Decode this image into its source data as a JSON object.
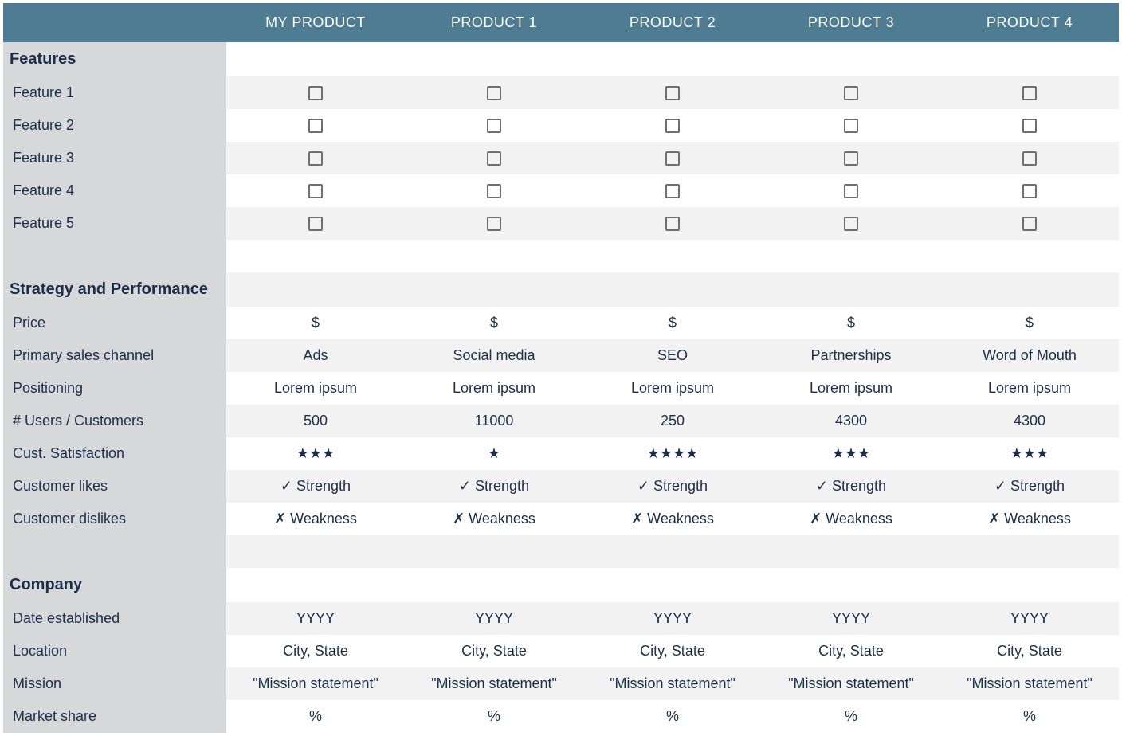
{
  "columns": [
    "MY PRODUCT",
    "PRODUCT 1",
    "PRODUCT 2",
    "PRODUCT 3",
    "PRODUCT 4"
  ],
  "sections": {
    "features": {
      "title": "Features",
      "rows": [
        "Feature 1",
        "Feature 2",
        "Feature 3",
        "Feature 4",
        "Feature 5"
      ]
    },
    "strategy": {
      "title": "Strategy and Performance",
      "rows": {
        "price": {
          "label": "Price",
          "values": [
            "$",
            "$",
            "$",
            "$",
            "$"
          ]
        },
        "channel": {
          "label": "Primary sales channel",
          "values": [
            "Ads",
            "Social media",
            "SEO",
            "Partnerships",
            "Word of Mouth"
          ]
        },
        "positioning": {
          "label": "Positioning",
          "values": [
            "Lorem ipsum",
            "Lorem ipsum",
            "Lorem ipsum",
            "Lorem ipsum",
            "Lorem ipsum"
          ]
        },
        "users": {
          "label": "# Users / Customers",
          "values": [
            "500",
            "11000",
            "250",
            "4300",
            "4300"
          ]
        },
        "satisfaction": {
          "label": "Cust. Satisfaction",
          "values": [
            "★★★",
            "★",
            "★★★★",
            "★★★",
            "★★★"
          ]
        },
        "likes": {
          "label": "Customer likes",
          "values": [
            "✓ Strength",
            "✓ Strength",
            "✓ Strength",
            "✓ Strength",
            "✓ Strength"
          ]
        },
        "dislikes": {
          "label": "Customer dislikes",
          "values": [
            "✗ Weakness",
            "✗ Weakness",
            "✗ Weakness",
            "✗ Weakness",
            "✗ Weakness"
          ]
        }
      }
    },
    "company": {
      "title": "Company",
      "rows": {
        "date": {
          "label": "Date established",
          "values": [
            "YYYY",
            "YYYY",
            "YYYY",
            "YYYY",
            "YYYY"
          ]
        },
        "location": {
          "label": "Location",
          "values": [
            "City, State",
            "City, State",
            "City, State",
            "City, State",
            "City, State"
          ]
        },
        "mission": {
          "label": "Mission",
          "values": [
            "\"Mission statement\"",
            "\"Mission statement\"",
            "\"Mission statement\"",
            "\"Mission statement\"",
            "\"Mission statement\""
          ]
        },
        "share": {
          "label": "Market share",
          "values": [
            "%",
            "%",
            "%",
            "%",
            "%"
          ]
        }
      }
    }
  }
}
